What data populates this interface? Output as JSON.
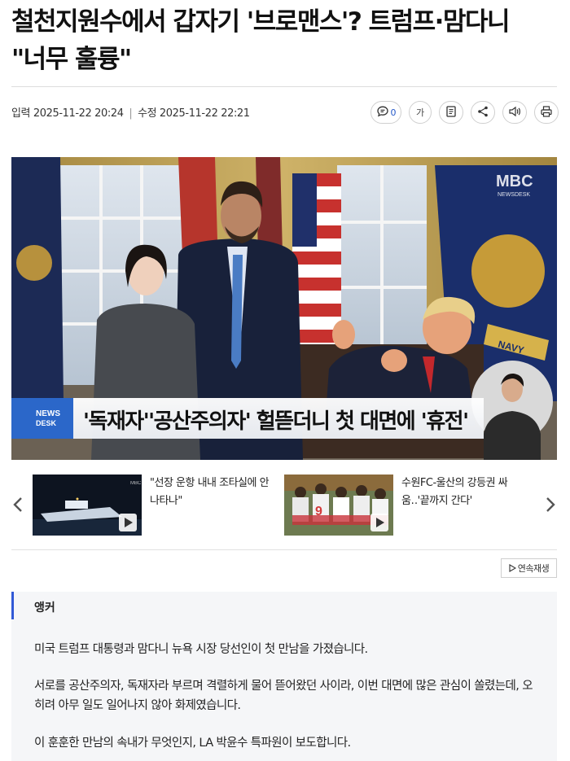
{
  "article": {
    "headline_line1": "철천지원수에서 갑자기 '브로맨스'? 트럼프·맘다니",
    "headline_line2": "\"너무 훌륭\"",
    "input_label": "입력 2025-11-22 20:24",
    "edit_label": "수정 2025-11-22 22:21",
    "separator": "|"
  },
  "toolbar": {
    "comment_count": "0",
    "font_label": "가"
  },
  "hero": {
    "caption": "'독재자''공산주의자' 헐뜯더니 첫 대면에 '휴전'",
    "news_badge_top": "NEWS",
    "news_badge_bottom": "DESK",
    "mbc_logo": "MBC",
    "mbc_sub": "NEWSDESK",
    "flag_text": "NAVY"
  },
  "related": [
    {
      "title": "\"선장 운항 내내 조타실에 안 나타나\""
    },
    {
      "title": "수원FC-울산의 강등권 싸움‥'끝까지 간다'"
    }
  ],
  "autoplay_label": "연속재생",
  "body": {
    "anchor_label": "앵커",
    "paragraphs": [
      "미국 트럼프 대통령과 맘다니 뉴욕 시장 당선인이 첫 만남을 가졌습니다.",
      "서로를 공산주의자, 독재자라 부르며 격렬하게 물어 뜯어왔던 사이라, 이번 대면에 많은 관심이 쏠렸는데, 오히려 아무 일도 일어나지 않아 화제였습니다.",
      "이 훈훈한 만남의 속내가 무엇인지, LA 박윤수 특파원이 보도합니다."
    ]
  },
  "icons": [
    "comment-icon",
    "font-size-icon",
    "bookmark-icon",
    "share-icon",
    "tts-icon",
    "print-icon",
    "chevron-left-icon",
    "chevron-right-icon",
    "play-icon"
  ],
  "colors": {
    "accent": "#3159d6",
    "caption_bg": "#ffffff",
    "news_blue": "#2b67c9"
  }
}
